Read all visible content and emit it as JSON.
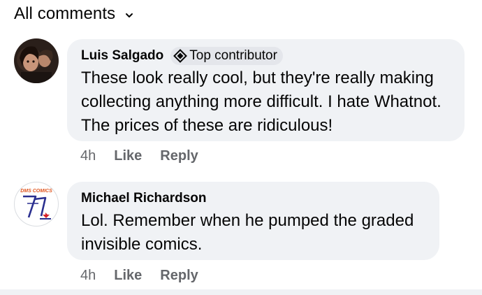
{
  "header": {
    "title": "All comments"
  },
  "comments": [
    {
      "author": "Luis Salgado",
      "badge": "Top contributor",
      "text": "These look really cool, but they're really making collecting anything more difficult. I hate Whatnot.  The prices of these are ridiculous!",
      "time": "4h",
      "like": "Like",
      "reply": "Reply"
    },
    {
      "author": "Michael Richardson",
      "avatar_text": "DMS COMICS",
      "text": "Lol. Remember when he pumped the graded invisible comics.",
      "time": "4h",
      "like": "Like",
      "reply": "Reply"
    }
  ],
  "colors": {
    "bubble": "#f0f2f5",
    "muted": "#65676b",
    "text": "#050505"
  }
}
